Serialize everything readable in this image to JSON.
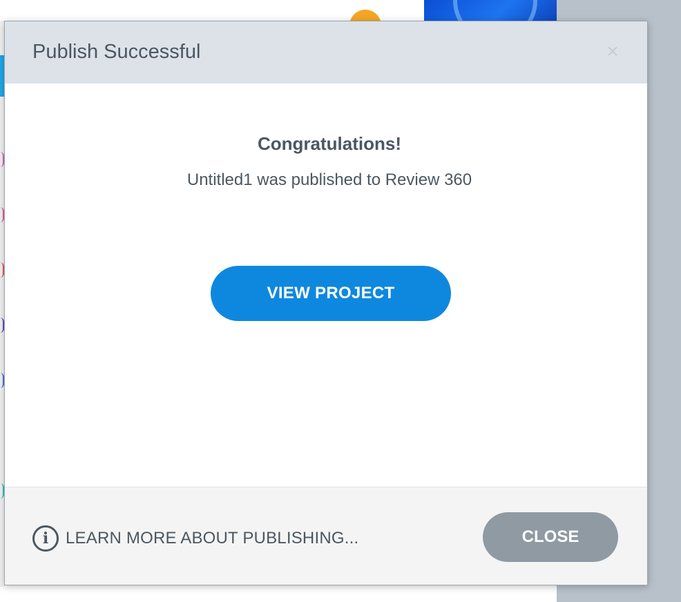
{
  "dialog": {
    "title": "Publish Successful",
    "close_x": "×",
    "heading": "Congratulations!",
    "message": "Untitled1 was published to Review 360",
    "view_project_label": "VIEW PROJECT",
    "learn_more_label": "LEARN MORE ABOUT PUBLISHING...",
    "info_icon_glyph": "i",
    "close_label": "CLOSE"
  },
  "icons": {
    "dialog_close": "close-icon",
    "learn_more": "info-icon"
  },
  "colors": {
    "header_bg": "#dce2e8",
    "primary_button": "#0e88de",
    "secondary_button": "#8f9aa3",
    "text": "#4b5761"
  }
}
